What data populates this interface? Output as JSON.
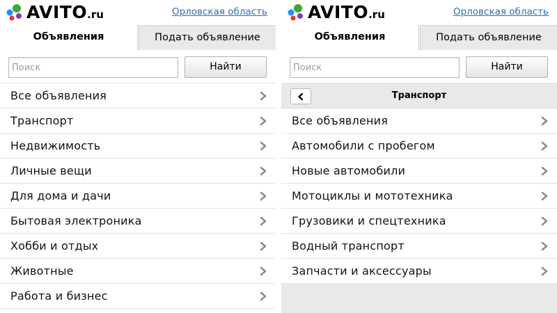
{
  "left": {
    "logo": {
      "text": "AVITO",
      "tld": ".ru"
    },
    "region_link": "Орловская область",
    "tabs": [
      {
        "label": "Объявления",
        "active": true
      },
      {
        "label": "Подать объявление",
        "active": false
      }
    ],
    "search": {
      "placeholder": "Поиск",
      "button": "Найти"
    },
    "items": [
      {
        "label": "Все объявления"
      },
      {
        "label": "Транспорт"
      },
      {
        "label": "Недвижимость"
      },
      {
        "label": "Личные вещи"
      },
      {
        "label": "Для дома и дачи"
      },
      {
        "label": "Бытовая электроника"
      },
      {
        "label": "Хобби и отдых"
      },
      {
        "label": "Животные"
      },
      {
        "label": "Работа и бизнес"
      }
    ]
  },
  "right": {
    "logo": {
      "text": "AVITO",
      "tld": ".ru"
    },
    "region_link": "Орловская область",
    "tabs": [
      {
        "label": "Объявления",
        "active": true
      },
      {
        "label": "Подать объявление",
        "active": false
      }
    ],
    "search": {
      "placeholder": "Поиск",
      "button": "Найти"
    },
    "crumb": {
      "title": "Транспорт"
    },
    "items": [
      {
        "label": "Все объявления"
      },
      {
        "label": "Автомобили с пробегом"
      },
      {
        "label": "Новые автомобили"
      },
      {
        "label": "Мотоциклы и мототехника"
      },
      {
        "label": "Грузовики и спецтехника"
      },
      {
        "label": "Водный транспорт"
      },
      {
        "label": "Запчасти и аксессуары"
      }
    ]
  },
  "colors": {
    "link": "#2a6dbf",
    "logo_green": "#3aa935",
    "logo_blue": "#1e90ff",
    "logo_red": "#e8312a",
    "logo_purple": "#8a3ab9",
    "chevron": "#8c8c8c",
    "inactive_tab_bg": "#e9e9e9"
  },
  "icons": {
    "logo": "avito-dots-logo",
    "list_chevron": "chevron-right-icon",
    "back": "chevron-left-icon"
  }
}
